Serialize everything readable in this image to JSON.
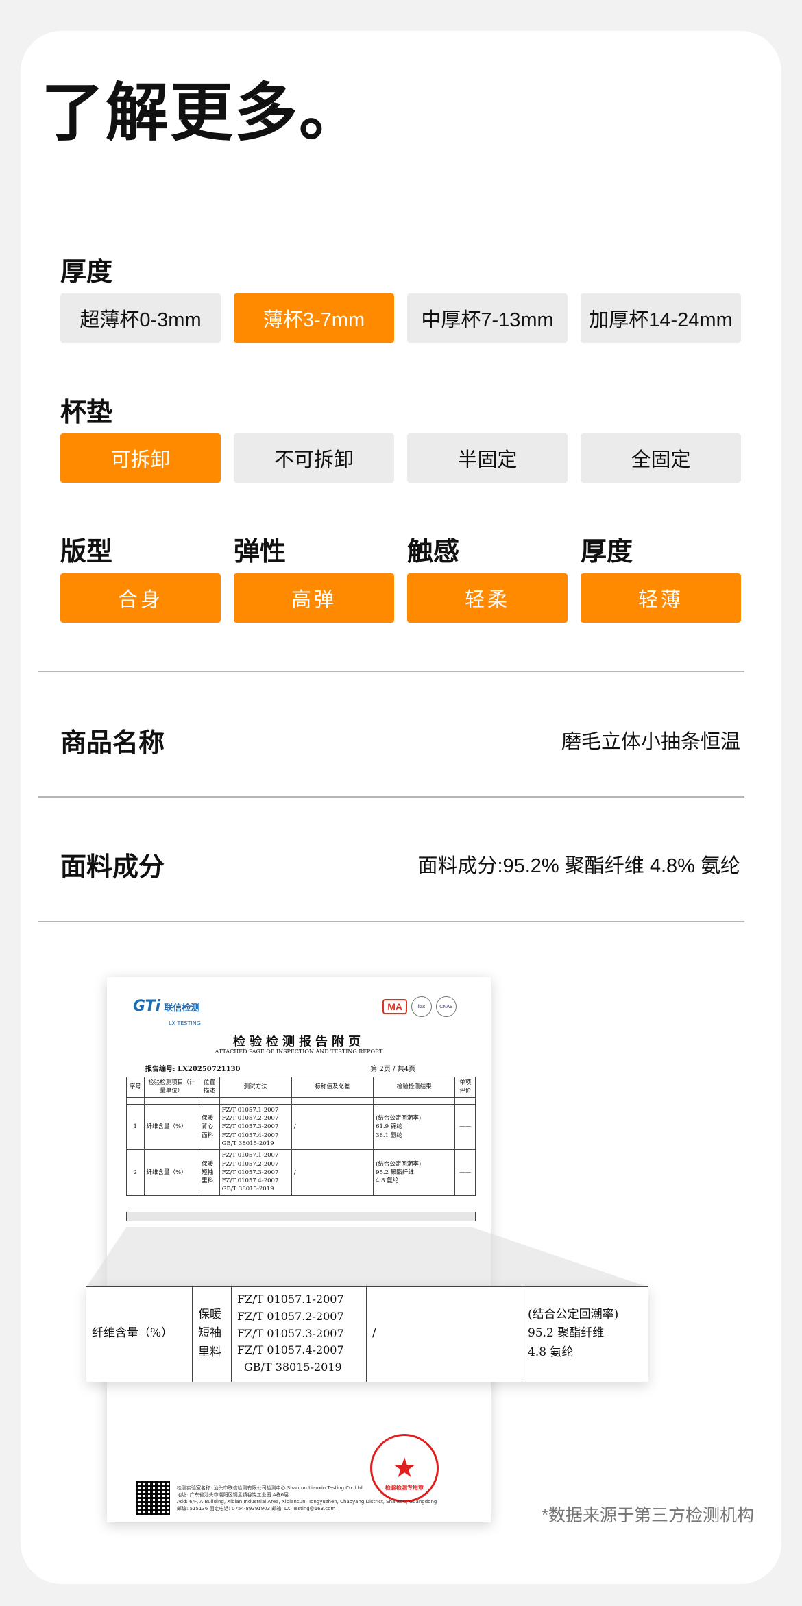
{
  "title": "了解更多。",
  "thickness": {
    "label": "厚度",
    "options": [
      {
        "label": "超薄杯0-3mm",
        "selected": false
      },
      {
        "label": "薄杯3-7mm",
        "selected": true
      },
      {
        "label": "中厚杯7-13mm",
        "selected": false
      },
      {
        "label": "加厚杯14-24mm",
        "selected": false
      }
    ]
  },
  "pad": {
    "label": "杯垫",
    "options": [
      {
        "label": "可拆卸",
        "selected": true
      },
      {
        "label": "不可拆卸",
        "selected": false
      },
      {
        "label": "半固定",
        "selected": false
      },
      {
        "label": "全固定",
        "selected": false
      }
    ]
  },
  "attributes": [
    {
      "label": "版型",
      "value": "合身"
    },
    {
      "label": "弹性",
      "value": "高弹"
    },
    {
      "label": "触感",
      "value": "轻柔"
    },
    {
      "label": "厚度",
      "value": "轻薄"
    }
  ],
  "product_name": {
    "label": "商品名称",
    "value": "磨毛立体小抽条恒温"
  },
  "fabric": {
    "label": "面料成分",
    "value": "面料成分:95.2% 聚酯纤维 4.8% 氨纶"
  },
  "report": {
    "logo_mark": "GTi",
    "logo_cn": "联信检测",
    "logo_en": "LX TESTING",
    "ma": "MA",
    "title": "检验检测报告附页",
    "subtitle": "ATTACHED PAGE OF INSPECTION AND TESTING REPORT",
    "report_no": "报告编号: LX20250721130",
    "page": "第 2页 / 共4页",
    "headers": [
      "序号",
      "检验检测项目（计量单位）",
      "位置描述",
      "测试方法",
      "标称值及允差",
      "检验检测结果",
      "单项评价"
    ],
    "rows": [
      {
        "no": "1",
        "item": "纤维含量（%）",
        "pos": "保暖背心面料",
        "methods": [
          "FZ/T 01057.1-2007",
          "FZ/T 01057.2-2007",
          "FZ/T 01057.3-2007",
          "FZ/T 01057.4-2007",
          "GB/T 38015-2019"
        ],
        "nominal": "/",
        "result": [
          "(结合公定回潮率)",
          "61.9  锦纶",
          "38.1  氨纶"
        ],
        "eval": "——"
      },
      {
        "no": "2",
        "item": "纤维含量（%）",
        "pos": "保暖短袖里料",
        "methods": [
          "FZ/T 01057.1-2007",
          "FZ/T 01057.2-2007",
          "FZ/T 01057.3-2007",
          "FZ/T 01057.4-2007",
          "GB/T 38015-2019"
        ],
        "nominal": "/",
        "result": [
          "(结合公定回潮率)",
          "95.2  聚酯纤维",
          "4.8  氨纶"
        ],
        "eval": "——"
      }
    ],
    "footer_lines": [
      "检测实验室名称: 汕头市联信检测有限公司检测中心  Shantou Lianxin Testing Co.,Ltd.",
      "地址: 广东省汕头市潮阳区铜盂镇谷饶工业园 A栋6层",
      "Add: 6/F, A Building, Xibian Industrial Area, Xibiancun, Tongyuzhen, Chaoyang District, Shantou, Guangdong",
      "邮编: 515136   固定电话: 0754-89391903   邮箱: LX_Testing@163.com"
    ],
    "stamp_text": "检验检测专用章"
  },
  "zoom": {
    "item": "纤维含量（%）",
    "pos": [
      "保暖",
      "短袖",
      "里料"
    ],
    "methods": [
      "FZ/T 01057.1-2007",
      "FZ/T 01057.2-2007",
      "FZ/T 01057.3-2007",
      "FZ/T 01057.4-2007",
      "GB/T 38015-2019"
    ],
    "nominal": "/",
    "result": [
      "(结合公定回潮率)",
      "95.2  聚酯纤维",
      "4.8  氨纶"
    ]
  },
  "source_note": "*数据来源于第三方检测机构"
}
